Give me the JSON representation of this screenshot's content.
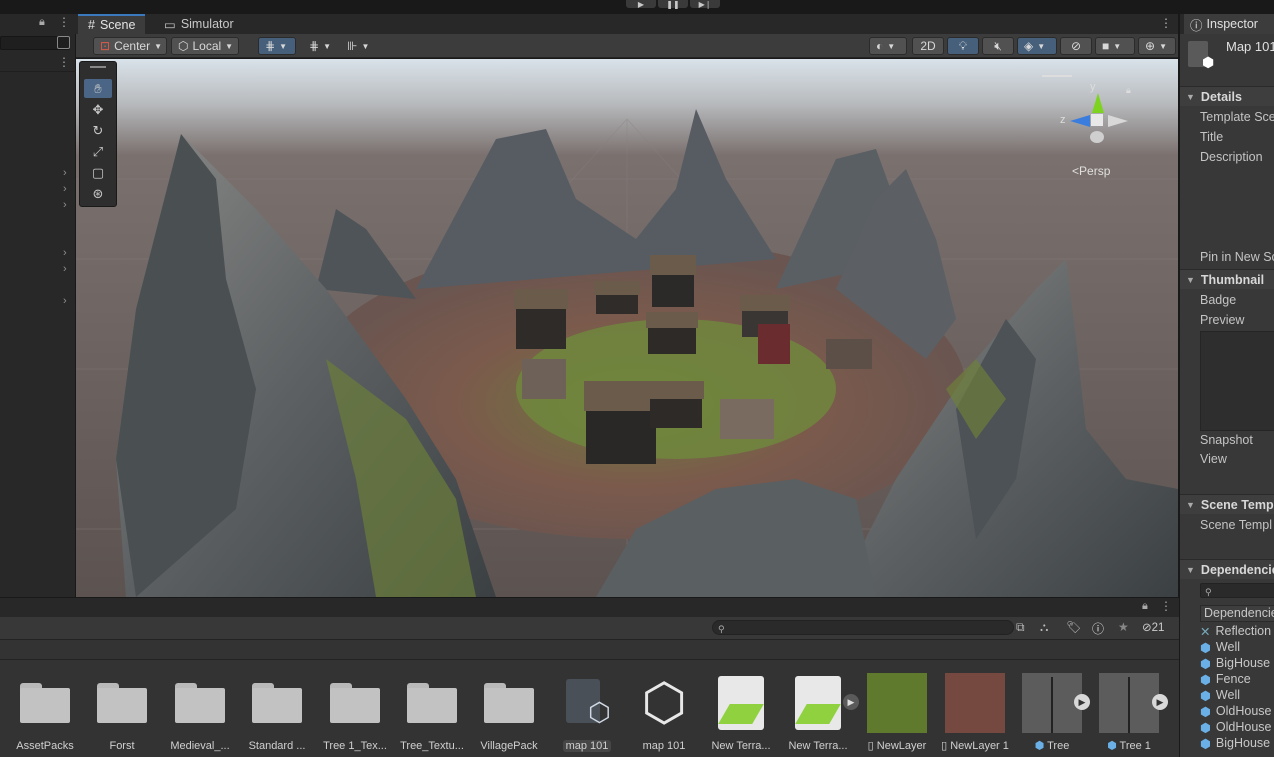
{
  "playbar": {
    "play": "▶",
    "pause": "❚❚",
    "step": "▶❘"
  },
  "scene_tabs": [
    {
      "label": "Scene",
      "icon": "grid-icon",
      "active": true
    },
    {
      "label": "Simulator",
      "icon": "monitor-icon",
      "active": false
    }
  ],
  "scene_toolbar": {
    "pivot": "Center",
    "space": "Local",
    "mode_2d": "2D",
    "persp": "Persp"
  },
  "gizmo_axes": {
    "y": "y",
    "z": "z"
  },
  "inspector": {
    "tab": "Inspector",
    "asset_name": "Map 101",
    "sections": {
      "details": "Details",
      "thumbnail": "Thumbnail",
      "scene_template": "Scene Temp",
      "dependencies": "Dependencie"
    },
    "details_rows": [
      "Template Sce",
      "Title",
      "Description"
    ],
    "pin": "Pin in New Sc",
    "thumbnail_rows": [
      "Badge",
      "Preview"
    ],
    "snapshot_rows": [
      "Snapshot",
      "View"
    ],
    "scene_template_row": "Scene Templ",
    "dep_header": "Dependencie",
    "dependencies": [
      {
        "name": "Reflection",
        "icon": "reflection-icon"
      },
      {
        "name": "Well",
        "icon": "prefab-icon"
      },
      {
        "name": "BigHouse",
        "icon": "prefab-icon"
      },
      {
        "name": "Fence",
        "icon": "prefab-icon"
      },
      {
        "name": "Well",
        "icon": "prefab-icon"
      },
      {
        "name": "OldHouse",
        "icon": "prefab-icon"
      },
      {
        "name": "OldHouse",
        "icon": "prefab-icon"
      },
      {
        "name": "BigHouse",
        "icon": "prefab-icon"
      }
    ]
  },
  "project": {
    "hidden_count": "21",
    "assets": [
      {
        "name": "AssetPacks",
        "kind": "folder"
      },
      {
        "name": "Forst",
        "kind": "folder"
      },
      {
        "name": "Medieval_...",
        "kind": "folder"
      },
      {
        "name": "Standard ...",
        "kind": "folder"
      },
      {
        "name": "Tree 1_Tex...",
        "kind": "folder"
      },
      {
        "name": "Tree_Textu...",
        "kind": "folder"
      },
      {
        "name": "VillagePack",
        "kind": "folder"
      },
      {
        "name": "map 101",
        "kind": "scene-template"
      },
      {
        "name": "map 101",
        "kind": "unity-scene"
      },
      {
        "name": "New Terra...",
        "kind": "terrain"
      },
      {
        "name": "New Terra...",
        "kind": "terrain"
      },
      {
        "name": "NewLayer",
        "kind": "grass-layer"
      },
      {
        "name": "NewLayer 1",
        "kind": "dirt-layer"
      },
      {
        "name": "Tree",
        "kind": "tree"
      },
      {
        "name": "Tree 1",
        "kind": "tree"
      }
    ]
  },
  "colors": {
    "accent": "#3a79bb",
    "panel": "#383838",
    "dark": "#282828",
    "grass": "#6f8a3c",
    "dirt": "#7a4a44"
  }
}
